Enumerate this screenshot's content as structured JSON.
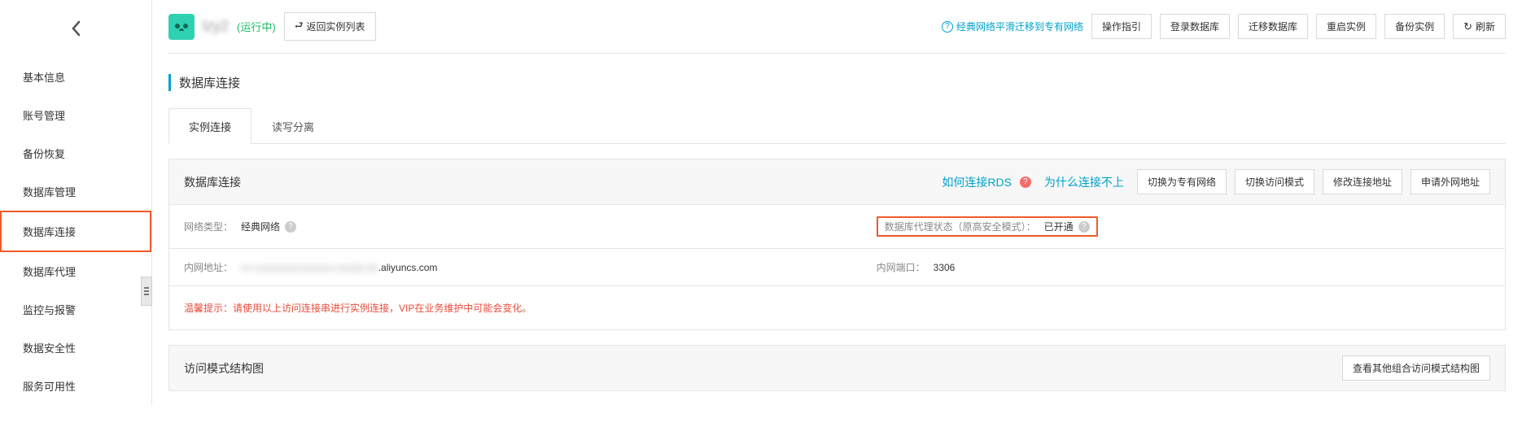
{
  "header": {
    "instance_name": "lzy2",
    "status": "(运行中)",
    "return_list": "返回实例列表",
    "migrate_link": "经典网络平滑迁移到专有网络",
    "actions": {
      "guide": "操作指引",
      "login_db": "登录数据库",
      "migrate_db": "迁移数据库",
      "restart": "重启实例",
      "backup": "备份实例",
      "refresh": "刷新"
    }
  },
  "sidebar": {
    "items": [
      "基本信息",
      "账号管理",
      "备份恢复",
      "数据库管理",
      "数据库连接",
      "数据库代理",
      "监控与报警",
      "数据安全性",
      "服务可用性"
    ],
    "active_index": 4
  },
  "section_title": "数据库连接",
  "tabs": {
    "items": [
      "实例连接",
      "读写分离"
    ],
    "active_index": 0
  },
  "conn_panel": {
    "title": "数据库连接",
    "links": {
      "how": "如何连接RDS",
      "why": "为什么连接不上"
    },
    "buttons": {
      "switch_vpc": "切换为专有网络",
      "switch_access": "切换访问模式",
      "modify_addr": "修改连接地址",
      "apply_external": "申请外网地址"
    },
    "row1": {
      "net_type_label": "网络类型：",
      "net_type_value": "经典网络",
      "proxy_label": "数据库代理状态（原高安全模式）：",
      "proxy_value": "已开通"
    },
    "row2": {
      "intranet_addr_label": "内网地址：",
      "intranet_addr_masked": "rm-xxxxxxxxxxxxxxxx.mysql.rds",
      "intranet_addr_suffix": ".aliyuncs.com",
      "intranet_port_label": "内网端口：",
      "intranet_port_value": "3306"
    },
    "warning": "温馨提示：请使用以上访问连接串进行实例连接，VIP在业务维护中可能会变化。"
  },
  "structure_panel": {
    "title": "访问模式结构图",
    "button": "查看其他组合访问模式结构图"
  }
}
